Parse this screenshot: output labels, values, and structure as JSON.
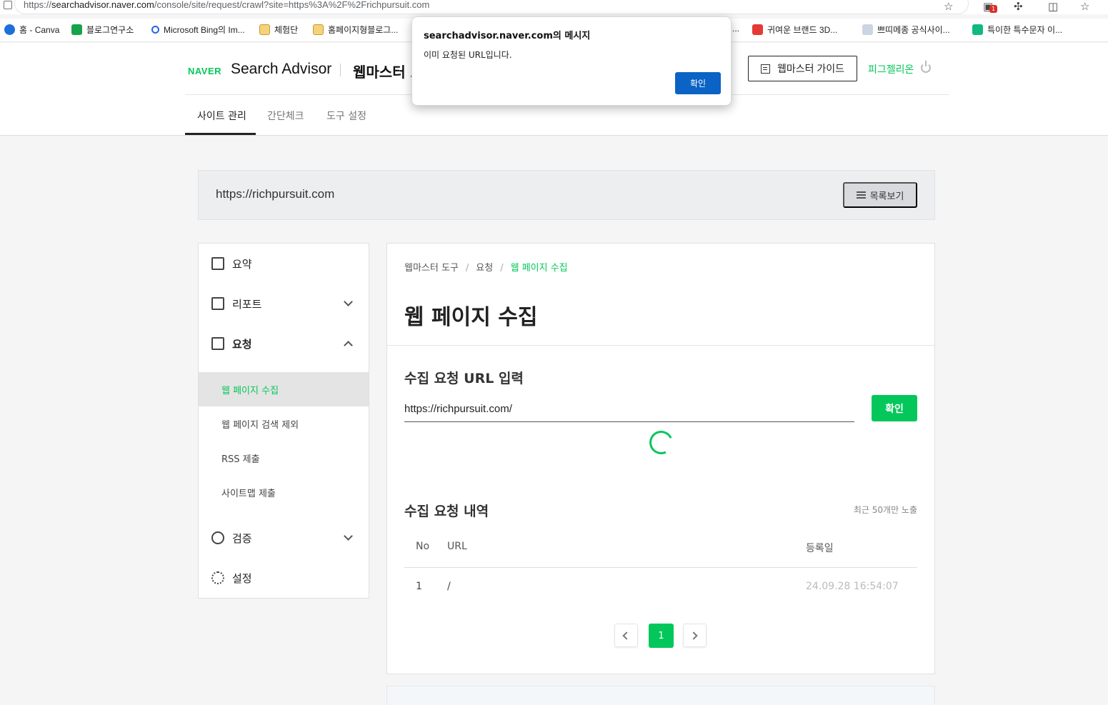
{
  "browser": {
    "url": "https://searchadvisor.naver.com/console/site/request/crawl?site=https%3A%2F%2Frichpursuit.com",
    "url_host": "searchadvisor.naver.com",
    "url_scheme": "https://",
    "url_rest": "/console/site/request/crawl?site=https%3A%2F%2Frichpursuit.com",
    "extension_badge": "1",
    "bookmarks": [
      {
        "label": "홈 - Canva",
        "color": "#1e6fd9"
      },
      {
        "label": "블로그연구소",
        "color": "#16a34a"
      },
      {
        "label": "Microsoft Bing의 Im...",
        "color": "#2563eb"
      },
      {
        "label": "체험단",
        "color": "#e0b43a"
      },
      {
        "label": "홈페이지형블로그...",
        "color": "#e0b43a"
      },
      {
        "label": "...",
        "color": "#ffffff"
      },
      {
        "label": "귀여운 브랜드 3D...",
        "color": "#e53935"
      },
      {
        "label": "쁘띠메종 공식사이...",
        "color": "#9ca3af"
      },
      {
        "label": "특이한 특수문자 이...",
        "color": "#10b981"
      }
    ]
  },
  "header": {
    "logo_naver": "NAVER",
    "logo_sa": "Search Advisor",
    "title_partial": "웹마스터 도",
    "guide_button": "웹마스터 가이드",
    "user_name": "피그젤리온",
    "tabs": [
      {
        "label": "사이트 관리"
      },
      {
        "label": "간단체크"
      },
      {
        "label": "도구 설정"
      }
    ]
  },
  "site_bar": {
    "site_url": "https://richpursuit.com",
    "list_button": "목록보기"
  },
  "sidebar": {
    "summary": "요약",
    "report": "리포트",
    "request": "요청",
    "sub_items": [
      {
        "label": "웹 페이지 수집"
      },
      {
        "label": "웹 페이지 검색 제외"
      },
      {
        "label": "RSS 제출"
      },
      {
        "label": "사이트맵 제출"
      }
    ],
    "verify": "검증",
    "settings": "설정"
  },
  "main": {
    "breadcrumb": [
      "웹마스터 도구",
      "요청",
      "웹 페이지 수집"
    ],
    "page_title": "웹 페이지 수집",
    "input_section_title": "수집 요청 URL 입력",
    "input_value": "https://richpursuit.com/",
    "confirm_button": "확인",
    "history_title": "수집 요청 내역",
    "recent_note": "최근 50개만 노출",
    "table": {
      "headers": [
        "No",
        "URL",
        "등록일"
      ],
      "rows": [
        {
          "no": "1",
          "url": "/",
          "date": "24.09.28 16:54:07"
        }
      ]
    },
    "current_page": "1"
  },
  "dialog": {
    "title": "searchadvisor.naver.com의 메시지",
    "message": "이미 요청된 URL입니다.",
    "ok_button": "확인"
  },
  "colors": {
    "accent": "#03c75a",
    "dialog_button": "#0b63c5"
  }
}
